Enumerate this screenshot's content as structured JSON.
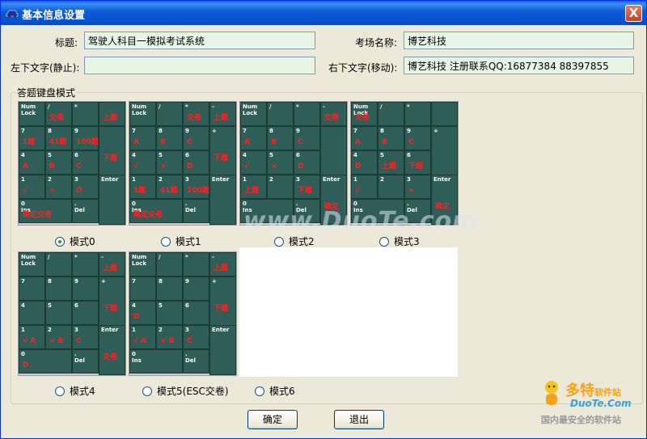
{
  "window": {
    "title": "基本信息设置",
    "close": "X"
  },
  "form": {
    "title_label": "标题:",
    "title_value": "驾驶人科目一模拟考试系统",
    "venue_label": "考场名称:",
    "venue_value": "博艺科技",
    "left_label": "左下文字(静止):",
    "left_value": "",
    "right_label": "右下文字(移动):",
    "right_value": "博艺科技  注册联系QQ:16877384  88397855"
  },
  "group": {
    "label": "答题键盘模式"
  },
  "modes": [
    {
      "label": "模式0",
      "selected": true
    },
    {
      "label": "模式1",
      "selected": false
    },
    {
      "label": "模式2",
      "selected": false
    },
    {
      "label": "模式3",
      "selected": false
    },
    {
      "label": "模式4",
      "selected": false
    },
    {
      "label": "模式5(ESC交卷)",
      "selected": false
    },
    {
      "label": "模式6",
      "selected": false
    }
  ],
  "keypads": [
    {
      "keys": [
        {
          "t": "Num\nLock",
          "l": ""
        },
        {
          "t": "/",
          "l": "交卷"
        },
        {
          "t": "*",
          "l": ""
        },
        {
          "t": "",
          "l": "上题"
        },
        {
          "t": "7",
          "l": "1题"
        },
        {
          "t": "8",
          "l": "41题"
        },
        {
          "t": "9",
          "l": "100题"
        },
        {
          "t": "",
          "l": "下题"
        },
        {
          "t": "4",
          "l": "A"
        },
        {
          "t": "5",
          "l": "B"
        },
        {
          "t": "6",
          "l": "C"
        },
        {
          "t": "1",
          "l": "√"
        },
        {
          "t": "2",
          "l": "×"
        },
        {
          "t": "3",
          "l": "D"
        },
        {
          "t": "Enter",
          "l": ""
        },
        {
          "t": "0\nIns",
          "l": "确定交卷"
        },
        {
          "t": ".\nDel",
          "l": ""
        }
      ]
    },
    {
      "keys": [
        {
          "t": "Num\nLock",
          "l": ""
        },
        {
          "t": "/",
          "l": ""
        },
        {
          "t": "*",
          "l": "交卷"
        },
        {
          "t": "-",
          "l": "上题"
        },
        {
          "t": "7",
          "l": "A"
        },
        {
          "t": "8",
          "l": "B"
        },
        {
          "t": "9",
          "l": "C"
        },
        {
          "t": "+",
          "l": "下题"
        },
        {
          "t": "4",
          "l": "√"
        },
        {
          "t": "5",
          "l": "×"
        },
        {
          "t": "6",
          "l": "D"
        },
        {
          "t": "1",
          "l": "1题"
        },
        {
          "t": "2",
          "l": "41题"
        },
        {
          "t": "3",
          "l": "100题"
        },
        {
          "t": "Enter",
          "l": ""
        },
        {
          "t": "0\nIns",
          "l": "确定交卷"
        },
        {
          "t": ".\nDel",
          "l": ""
        }
      ]
    },
    {
      "keys": [
        {
          "t": "Num\nLock",
          "l": ""
        },
        {
          "t": "/",
          "l": ""
        },
        {
          "t": "*",
          "l": ""
        },
        {
          "t": "-",
          "l": "交卷"
        },
        {
          "t": "7",
          "l": "A"
        },
        {
          "t": "8",
          "l": "B"
        },
        {
          "t": "9",
          "l": "C"
        },
        {
          "t": "",
          "l": ""
        },
        {
          "t": "4",
          "l": "√"
        },
        {
          "t": "5",
          "l": "×"
        },
        {
          "t": "6",
          "l": "D"
        },
        {
          "t": "1",
          "l": "上题"
        },
        {
          "t": "2",
          "l": ""
        },
        {
          "t": "3",
          "l": "下题"
        },
        {
          "t": "Enter",
          "l": "确定"
        },
        {
          "t": "0\nIns",
          "l": ""
        },
        {
          "t": ".\nDel",
          "l": ""
        }
      ]
    },
    {
      "keys": [
        {
          "t": "Num\nLock",
          "l": "交卷"
        },
        {
          "t": "/",
          "l": ""
        },
        {
          "t": "*",
          "l": ""
        },
        {
          "t": "",
          "l": ""
        },
        {
          "t": "7",
          "l": "A"
        },
        {
          "t": "8",
          "l": "B"
        },
        {
          "t": "9",
          "l": "C"
        },
        {
          "t": "+",
          "l": ""
        },
        {
          "t": "4",
          "l": "D"
        },
        {
          "t": "5",
          "l": "上题"
        },
        {
          "t": "6",
          "l": "下题"
        },
        {
          "t": "1",
          "l": "√"
        },
        {
          "t": "2",
          "l": ""
        },
        {
          "t": "3",
          "l": "×"
        },
        {
          "t": "Enter",
          "l": "确定"
        },
        {
          "t": "0\nIns",
          "l": ""
        },
        {
          "t": ".\nDel",
          "l": ""
        }
      ]
    },
    {
      "keys": [
        {
          "t": "Num\nLock",
          "l": ""
        },
        {
          "t": "/",
          "l": ""
        },
        {
          "t": "*",
          "l": ""
        },
        {
          "t": "-",
          "l": "上题"
        },
        {
          "t": "7",
          "l": ""
        },
        {
          "t": "8",
          "l": ""
        },
        {
          "t": "9",
          "l": ""
        },
        {
          "t": "+",
          "l": "下题"
        },
        {
          "t": "4",
          "l": ""
        },
        {
          "t": "5",
          "l": ""
        },
        {
          "t": "6",
          "l": ""
        },
        {
          "t": "1",
          "l": "√ A"
        },
        {
          "t": "2",
          "l": "× B"
        },
        {
          "t": "3",
          "l": "C"
        },
        {
          "t": "Enter",
          "l": "交卷"
        },
        {
          "t": "0",
          "l": "D"
        },
        {
          "t": ".\nDel",
          "l": ""
        }
      ]
    },
    {
      "keys": [
        {
          "t": "Num\nLock",
          "l": ""
        },
        {
          "t": "/",
          "l": ""
        },
        {
          "t": "*",
          "l": ""
        },
        {
          "t": "-",
          "l": "上题"
        },
        {
          "t": "7",
          "l": ""
        },
        {
          "t": "8",
          "l": ""
        },
        {
          "t": "9",
          "l": ""
        },
        {
          "t": "+",
          "l": "下题"
        },
        {
          "t": "4",
          "l": "D"
        },
        {
          "t": "5",
          "l": ""
        },
        {
          "t": "6",
          "l": ""
        },
        {
          "t": "1",
          "l": "√ A"
        },
        {
          "t": "2",
          "l": "× B"
        },
        {
          "t": "3",
          "l": "C"
        },
        {
          "t": "Enter",
          "l": ""
        },
        {
          "t": "0\nIns",
          "l": ""
        },
        {
          "t": ".\nDel",
          "l": ""
        }
      ]
    }
  ],
  "buttons": {
    "ok": "确定",
    "exit": "退出"
  },
  "watermark": "www.DuoTe.com",
  "brand": {
    "name": "多特",
    "suffix": "软件站",
    "url": "DuoTe.Com",
    "slogan": "国内最安全的软件站"
  }
}
